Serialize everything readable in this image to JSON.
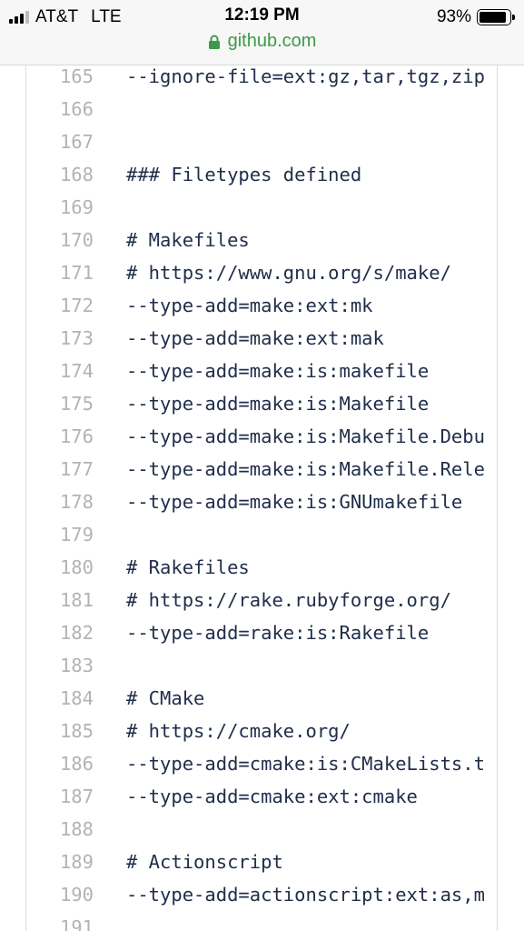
{
  "status_bar": {
    "carrier": "AT&T",
    "network": "LTE",
    "time": "12:19 PM",
    "battery_percent_label": "93%",
    "battery_level": 0.93,
    "signal_bars_filled": 3,
    "signal_bars_total": 4
  },
  "browser": {
    "url": "github.com",
    "url_color": "#3d9a48"
  },
  "code": {
    "lines": [
      {
        "num": "165",
        "text": "--ignore-file=ext:gz,tar,tgz,zip"
      },
      {
        "num": "166",
        "text": ""
      },
      {
        "num": "167",
        "text": ""
      },
      {
        "num": "168",
        "text": "### Filetypes defined"
      },
      {
        "num": "169",
        "text": ""
      },
      {
        "num": "170",
        "text": "# Makefiles"
      },
      {
        "num": "171",
        "text": "# https://www.gnu.org/s/make/"
      },
      {
        "num": "172",
        "text": "--type-add=make:ext:mk"
      },
      {
        "num": "173",
        "text": "--type-add=make:ext:mak"
      },
      {
        "num": "174",
        "text": "--type-add=make:is:makefile"
      },
      {
        "num": "175",
        "text": "--type-add=make:is:Makefile"
      },
      {
        "num": "176",
        "text": "--type-add=make:is:Makefile.Debu"
      },
      {
        "num": "177",
        "text": "--type-add=make:is:Makefile.Rele"
      },
      {
        "num": "178",
        "text": "--type-add=make:is:GNUmakefile"
      },
      {
        "num": "179",
        "text": ""
      },
      {
        "num": "180",
        "text": "# Rakefiles"
      },
      {
        "num": "181",
        "text": "# https://rake.rubyforge.org/"
      },
      {
        "num": "182",
        "text": "--type-add=rake:is:Rakefile"
      },
      {
        "num": "183",
        "text": ""
      },
      {
        "num": "184",
        "text": "# CMake"
      },
      {
        "num": "185",
        "text": "# https://cmake.org/"
      },
      {
        "num": "186",
        "text": "--type-add=cmake:is:CMakeLists.t"
      },
      {
        "num": "187",
        "text": "--type-add=cmake:ext:cmake"
      },
      {
        "num": "188",
        "text": ""
      },
      {
        "num": "189",
        "text": "# Actionscript"
      },
      {
        "num": "190",
        "text": "--type-add=actionscript:ext:as,m"
      },
      {
        "num": "191",
        "text": ""
      }
    ]
  }
}
